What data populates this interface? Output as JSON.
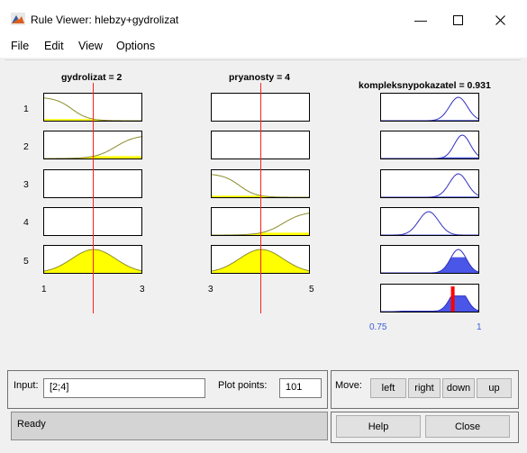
{
  "window": {
    "title": "Rule Viewer: hlebzy+gydrolizat"
  },
  "menu": [
    "File",
    "Edit",
    "View",
    "Options"
  ],
  "inputs": [
    {
      "label": "gydrolizat = 2",
      "range_min": "1",
      "range_max": "3",
      "value": 2,
      "min": 1,
      "max": 3
    },
    {
      "label": "pryanosty = 4",
      "range_min": "3",
      "range_max": "5",
      "value": 4,
      "min": 3,
      "max": 5
    }
  ],
  "output": {
    "label": "kompleksnypokazatel = 0.931",
    "range_min": "0.75",
    "range_max": "1",
    "value": 0.931,
    "min": 0.75,
    "max": 1
  },
  "rules": [
    "1",
    "2",
    "3",
    "4",
    "5"
  ],
  "controls": {
    "input_label": "Input:",
    "input_value": "[2;4]",
    "plot_points_label": "Plot points:",
    "plot_points_value": "101",
    "move_label": "Move:",
    "left": "left",
    "right": "right",
    "down": "down",
    "up": "up",
    "help": "Help",
    "close": "Close"
  },
  "status": "Ready",
  "colors": {
    "input_line": "#ff2020",
    "mf_line": "#8c8c2a",
    "fill_yellow": "#ffff00",
    "output_line": "#3030c0",
    "output_fill": "#4a56e8",
    "result_bar": "#ff0000",
    "tick_blue": "#3b5dd8"
  }
}
